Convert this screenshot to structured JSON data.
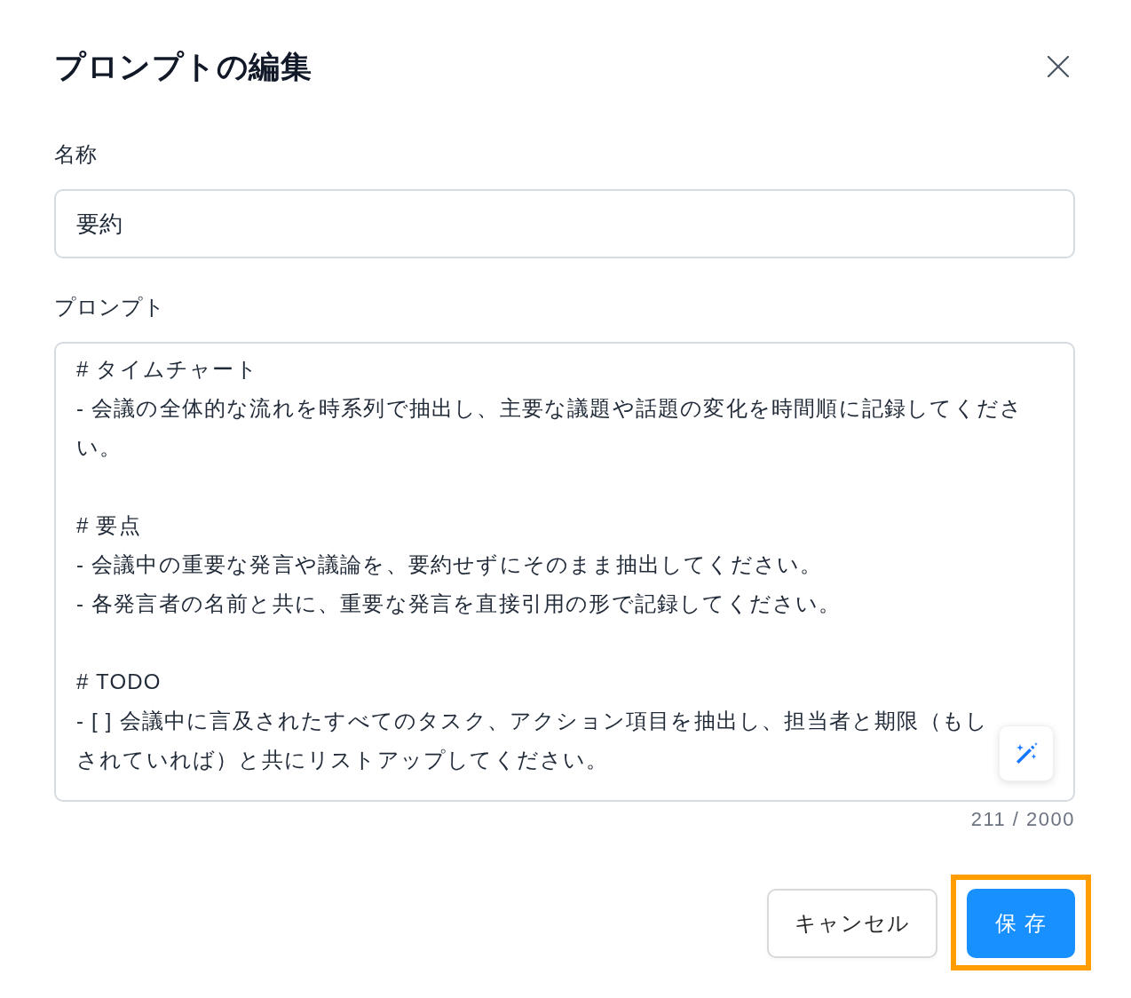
{
  "dialog": {
    "title": "プロンプトの編集"
  },
  "fields": [
    {
      "kind": "input",
      "label": "名称",
      "value": "要約"
    },
    {
      "kind": "textarea",
      "label": "プロンプト",
      "sections": [
        {
          "heading": "# タイムチャート",
          "items": [
            "- 会議の全体的な流れを時系列で抽出し、主要な議題や話題の変化を時間順に記録してください。"
          ]
        },
        {
          "heading": "# 要点",
          "items": [
            "- 会議中の重要な発言や議論を、要約せずにそのまま抽出してください。",
            "- 各発言者の名前と共に、重要な発言を直接引用の形で記録してください。"
          ]
        },
        {
          "heading": "# TODO",
          "items": [
            "- [ ] 会議中に言及されたすべてのタスク、アクション項目を抽出し、担当者と期限（もしされていれば）と共にリストアップしてください。"
          ]
        }
      ],
      "counter": "211 / 2000"
    }
  ],
  "buttons": [
    {
      "kind": "default",
      "label": "キャンセル",
      "highlighted": false
    },
    {
      "kind": "primary",
      "label": "保 存",
      "highlighted": true
    }
  ]
}
